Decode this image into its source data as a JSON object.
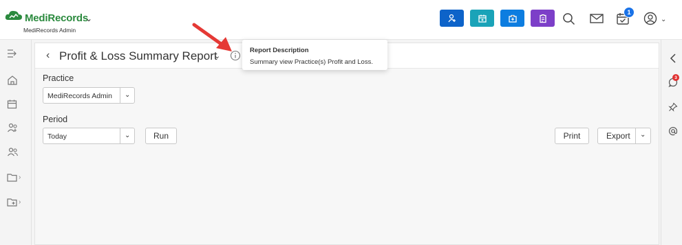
{
  "app": {
    "brand": "MediRecords",
    "practice_name": "MediRecords Admin"
  },
  "header": {
    "quick_actions": [
      {
        "name": "add-patient",
        "color": "#0d63c9"
      },
      {
        "name": "calendar",
        "color": "#1aa3b8"
      },
      {
        "name": "medical-case",
        "color": "#0d7de0"
      },
      {
        "name": "clipboard",
        "color": "#7c3fc8"
      }
    ],
    "notification_count": "1"
  },
  "page": {
    "title": "Profit & Loss Summary Report"
  },
  "form": {
    "practice_label": "Practice",
    "practice_value": "MediRecords Admin",
    "period_label": "Period",
    "period_value": "Today",
    "run_label": "Run",
    "print_label": "Print",
    "export_label": "Export"
  },
  "tooltip": {
    "title": "Report Description",
    "body": "Summary view Practice(s) Profit and Loss."
  },
  "right_sidebar": {
    "comments_badge": "3"
  },
  "colors": {
    "brand_green": "#2b8a3e",
    "accent_blue": "#1a73e8",
    "annotation_red": "#e53935"
  }
}
